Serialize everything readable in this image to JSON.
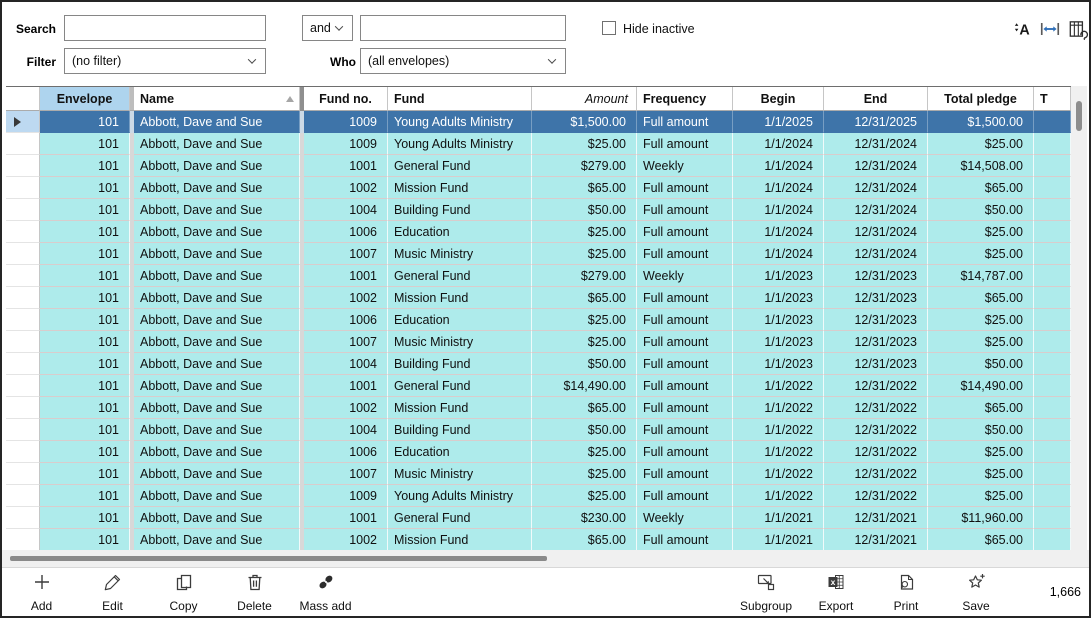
{
  "filters": {
    "search_label": "Search",
    "search_value": "",
    "operator_value": "and",
    "search2_value": "",
    "hide_inactive_label": "Hide inactive",
    "hide_inactive_checked": false,
    "filter_label": "Filter",
    "filter_value": "(no filter)",
    "who_label": "Who",
    "who_value": "(all envelopes)"
  },
  "header_icons": [
    {
      "name": "text-size-icon"
    },
    {
      "name": "fit-column-width-icon"
    },
    {
      "name": "grid-columns-icon"
    }
  ],
  "grid": {
    "columns": [
      {
        "key": "envelope",
        "label": "Envelope",
        "align": "right",
        "header_align": "center",
        "header_bg": "#aed4ee"
      },
      {
        "key": "name",
        "label": "Name",
        "align": "left",
        "header_align": "left",
        "sort": "asc"
      },
      {
        "key": "fund_no",
        "label": "Fund no.",
        "align": "right",
        "header_align": "center"
      },
      {
        "key": "fund",
        "label": "Fund",
        "align": "left",
        "header_align": "left"
      },
      {
        "key": "amount",
        "label": "Amount",
        "align": "right",
        "header_align": "right",
        "italic": true
      },
      {
        "key": "frequency",
        "label": "Frequency",
        "align": "left",
        "header_align": "left"
      },
      {
        "key": "begin",
        "label": "Begin",
        "align": "right",
        "header_align": "center"
      },
      {
        "key": "end",
        "label": "End",
        "align": "right",
        "header_align": "center"
      },
      {
        "key": "total_pledge",
        "label": "Total pledge",
        "align": "right",
        "header_align": "center"
      },
      {
        "key": "truncated",
        "label": "T",
        "align": "left",
        "header_align": "left"
      }
    ],
    "selected_row_index": 0,
    "rows": [
      [
        "101",
        "Abbott, Dave and Sue",
        "1009",
        "Young Adults Ministry",
        "$1,500.00",
        "Full amount",
        "1/1/2025",
        "12/31/2025",
        "$1,500.00"
      ],
      [
        "101",
        "Abbott, Dave and Sue",
        "1009",
        "Young Adults Ministry",
        "$25.00",
        "Full amount",
        "1/1/2024",
        "12/31/2024",
        "$25.00"
      ],
      [
        "101",
        "Abbott, Dave and Sue",
        "1001",
        "General Fund",
        "$279.00",
        "Weekly",
        "1/1/2024",
        "12/31/2024",
        "$14,508.00"
      ],
      [
        "101",
        "Abbott, Dave and Sue",
        "1002",
        "Mission Fund",
        "$65.00",
        "Full amount",
        "1/1/2024",
        "12/31/2024",
        "$65.00"
      ],
      [
        "101",
        "Abbott, Dave and Sue",
        "1004",
        "Building Fund",
        "$50.00",
        "Full amount",
        "1/1/2024",
        "12/31/2024",
        "$50.00"
      ],
      [
        "101",
        "Abbott, Dave and Sue",
        "1006",
        "Education",
        "$25.00",
        "Full amount",
        "1/1/2024",
        "12/31/2024",
        "$25.00"
      ],
      [
        "101",
        "Abbott, Dave and Sue",
        "1007",
        "Music Ministry",
        "$25.00",
        "Full amount",
        "1/1/2024",
        "12/31/2024",
        "$25.00"
      ],
      [
        "101",
        "Abbott, Dave and Sue",
        "1001",
        "General Fund",
        "$279.00",
        "Weekly",
        "1/1/2023",
        "12/31/2023",
        "$14,787.00"
      ],
      [
        "101",
        "Abbott, Dave and Sue",
        "1002",
        "Mission Fund",
        "$65.00",
        "Full amount",
        "1/1/2023",
        "12/31/2023",
        "$65.00"
      ],
      [
        "101",
        "Abbott, Dave and Sue",
        "1006",
        "Education",
        "$25.00",
        "Full amount",
        "1/1/2023",
        "12/31/2023",
        "$25.00"
      ],
      [
        "101",
        "Abbott, Dave and Sue",
        "1007",
        "Music Ministry",
        "$25.00",
        "Full amount",
        "1/1/2023",
        "12/31/2023",
        "$25.00"
      ],
      [
        "101",
        "Abbott, Dave and Sue",
        "1004",
        "Building Fund",
        "$50.00",
        "Full amount",
        "1/1/2023",
        "12/31/2023",
        "$50.00"
      ],
      [
        "101",
        "Abbott, Dave and Sue",
        "1001",
        "General Fund",
        "$14,490.00",
        "Full amount",
        "1/1/2022",
        "12/31/2022",
        "$14,490.00"
      ],
      [
        "101",
        "Abbott, Dave and Sue",
        "1002",
        "Mission Fund",
        "$65.00",
        "Full amount",
        "1/1/2022",
        "12/31/2022",
        "$65.00"
      ],
      [
        "101",
        "Abbott, Dave and Sue",
        "1004",
        "Building Fund",
        "$50.00",
        "Full amount",
        "1/1/2022",
        "12/31/2022",
        "$50.00"
      ],
      [
        "101",
        "Abbott, Dave and Sue",
        "1006",
        "Education",
        "$25.00",
        "Full amount",
        "1/1/2022",
        "12/31/2022",
        "$25.00"
      ],
      [
        "101",
        "Abbott, Dave and Sue",
        "1007",
        "Music Ministry",
        "$25.00",
        "Full amount",
        "1/1/2022",
        "12/31/2022",
        "$25.00"
      ],
      [
        "101",
        "Abbott, Dave and Sue",
        "1009",
        "Young Adults Ministry",
        "$25.00",
        "Full amount",
        "1/1/2022",
        "12/31/2022",
        "$25.00"
      ],
      [
        "101",
        "Abbott, Dave and Sue",
        "1001",
        "General Fund",
        "$230.00",
        "Weekly",
        "1/1/2021",
        "12/31/2021",
        "$11,960.00"
      ],
      [
        "101",
        "Abbott, Dave and Sue",
        "1002",
        "Mission Fund",
        "$65.00",
        "Full amount",
        "1/1/2021",
        "12/31/2021",
        "$65.00"
      ]
    ],
    "colors": {
      "row_bg": "#aeebeb",
      "selected_row_bg": "#3e74a9",
      "selected_row_text": "#ffffff",
      "envelope_header_bg": "#aed4ee",
      "selected_row_selector_bg": "#bdd9f1"
    }
  },
  "toolbar": {
    "left": [
      {
        "label": "Add",
        "icon": "plus-icon"
      },
      {
        "label": "Edit",
        "icon": "pencil-icon"
      },
      {
        "label": "Copy",
        "icon": "copy-icon"
      },
      {
        "label": "Delete",
        "icon": "trash-icon"
      },
      {
        "label": "Mass add",
        "icon": "coins-icon"
      }
    ],
    "right": [
      {
        "label": "Subgroup",
        "icon": "subgroup-icon"
      },
      {
        "label": "Export",
        "icon": "excel-icon"
      },
      {
        "label": "Print",
        "icon": "print-icon"
      },
      {
        "label": "Save",
        "icon": "star-plus-icon"
      }
    ],
    "record_count": "1,666"
  }
}
